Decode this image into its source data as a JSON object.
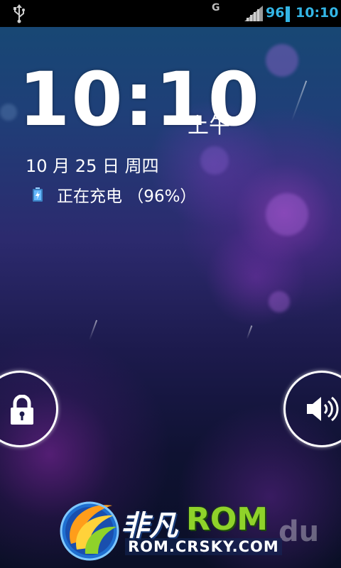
{
  "status_bar": {
    "network_type": "G",
    "battery_percent": "96",
    "time": "10:10",
    "icons": [
      "usb-icon",
      "signal-icon",
      "battery-icon"
    ],
    "accent_color": "#33b5e5"
  },
  "lockscreen": {
    "time": "10:10",
    "ampm": "上午",
    "date": "10 月 25 日 周四",
    "charging_status": "正在充电 （96%）",
    "unlock_target_icon": "lock-icon",
    "sound_target_icon": "speaker-icon"
  },
  "watermark": {
    "title_cn": "非凡",
    "title_rom": "ROM",
    "url": "ROM.CRSKY.COM",
    "ghost_text": "du"
  }
}
